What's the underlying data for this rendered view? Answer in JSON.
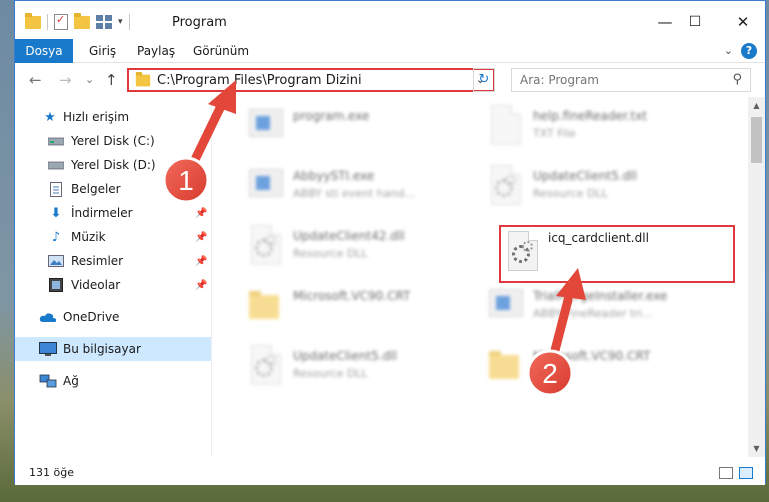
{
  "window": {
    "title": "Program",
    "minimize": "—",
    "maximize": "☐",
    "close": "✕"
  },
  "ribbon": {
    "tabs": [
      "Dosya",
      "Giriş",
      "Paylaş",
      "Görünüm"
    ],
    "help": "?",
    "expand": "⌄"
  },
  "nav": {
    "back": "←",
    "forward": "→",
    "recent": "⌄",
    "up": "↑",
    "address": "C:\\Program Files\\Program Dizini",
    "address_dropdown": "⌄",
    "refresh": "↻",
    "search_placeholder": "Ara: Program",
    "search_icon": "⚲"
  },
  "sidebar": {
    "items": [
      {
        "label": "Hızlı erişim",
        "icon": "star-icon"
      },
      {
        "label": "Yerel Disk (C:)",
        "icon": "drive-icon"
      },
      {
        "label": "Yerel Disk (D:)",
        "icon": "drive-icon"
      },
      {
        "label": "Belgeler",
        "icon": "documents-icon"
      },
      {
        "label": "İndirmeler",
        "icon": "download-icon"
      },
      {
        "label": "Müzik",
        "icon": "music-icon"
      },
      {
        "label": "Resimler",
        "icon": "pictures-icon"
      },
      {
        "label": "Videolar",
        "icon": "videos-icon"
      },
      {
        "label": "OneDrive",
        "icon": "cloud-icon"
      },
      {
        "label": "Bu bilgisayar",
        "icon": "computer-icon"
      },
      {
        "label": "Ağ",
        "icon": "network-icon"
      }
    ]
  },
  "files": [
    {
      "name": "program.exe",
      "type": ""
    },
    {
      "name": "help.fineReader.txt",
      "type": "TXT File"
    },
    {
      "name": "AbbyySTI.exe",
      "type": "ABBY sti event hand..."
    },
    {
      "name": "UpdateClient5.dll",
      "type": "Resource DLL"
    },
    {
      "name": "UpdateClient42.dll",
      "type": "Resource DLL"
    },
    {
      "name": "icq_cardclient.dll",
      "type": ""
    },
    {
      "name": "Microsoft.VC90.CRT",
      "type": ""
    },
    {
      "name": "TrialMergeInstaller.exe",
      "type": "ABBY FineReader tri..."
    },
    {
      "name": "UpdateClient5.dll",
      "type": "Resource DLL"
    },
    {
      "name": "Microsoft.VC90.CRT",
      "type": ""
    }
  ],
  "status": {
    "count": "131 öğe"
  },
  "annotations": {
    "step1": "1",
    "step2": "2"
  },
  "colors": {
    "accent": "#1979ca",
    "highlight": "#e0383e",
    "selected": "#cde8ff"
  }
}
